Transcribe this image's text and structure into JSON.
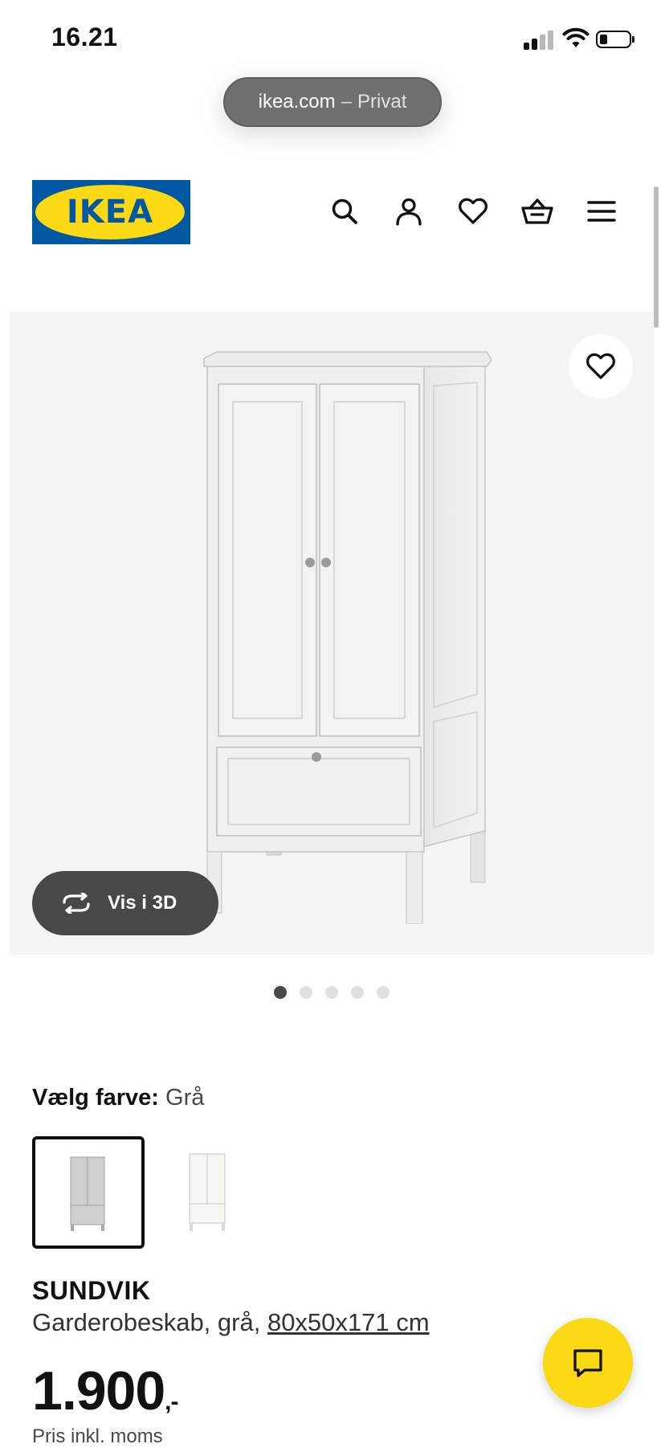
{
  "status_bar": {
    "time": "16.21"
  },
  "browser": {
    "domain": "ikea.com",
    "separator": "–",
    "mode": "Privat"
  },
  "header": {
    "logo_text": "IKEA",
    "icons": [
      "search-icon",
      "account-icon",
      "favourites-icon",
      "basket-icon",
      "menu-icon"
    ]
  },
  "product_image": {
    "view_3d_label": "Vis i 3D",
    "carousel_count": 5,
    "carousel_active_index": 0
  },
  "color_picker": {
    "label": "Vælg farve:",
    "selected": "Grå",
    "options": [
      {
        "name": "Grå",
        "selected": true
      },
      {
        "name": "Hvid",
        "selected": false
      }
    ]
  },
  "product": {
    "name": "SUNDVIK",
    "description": "Garderobeskab, grå,",
    "dimensions": "80x50x171 cm",
    "price": "1.900",
    "price_suffix": ",-",
    "price_note": "Pris inkl. moms"
  },
  "colors": {
    "ikea_blue": "#0058a3",
    "ikea_yellow": "#fbd914",
    "dark_pill": "#484848"
  }
}
